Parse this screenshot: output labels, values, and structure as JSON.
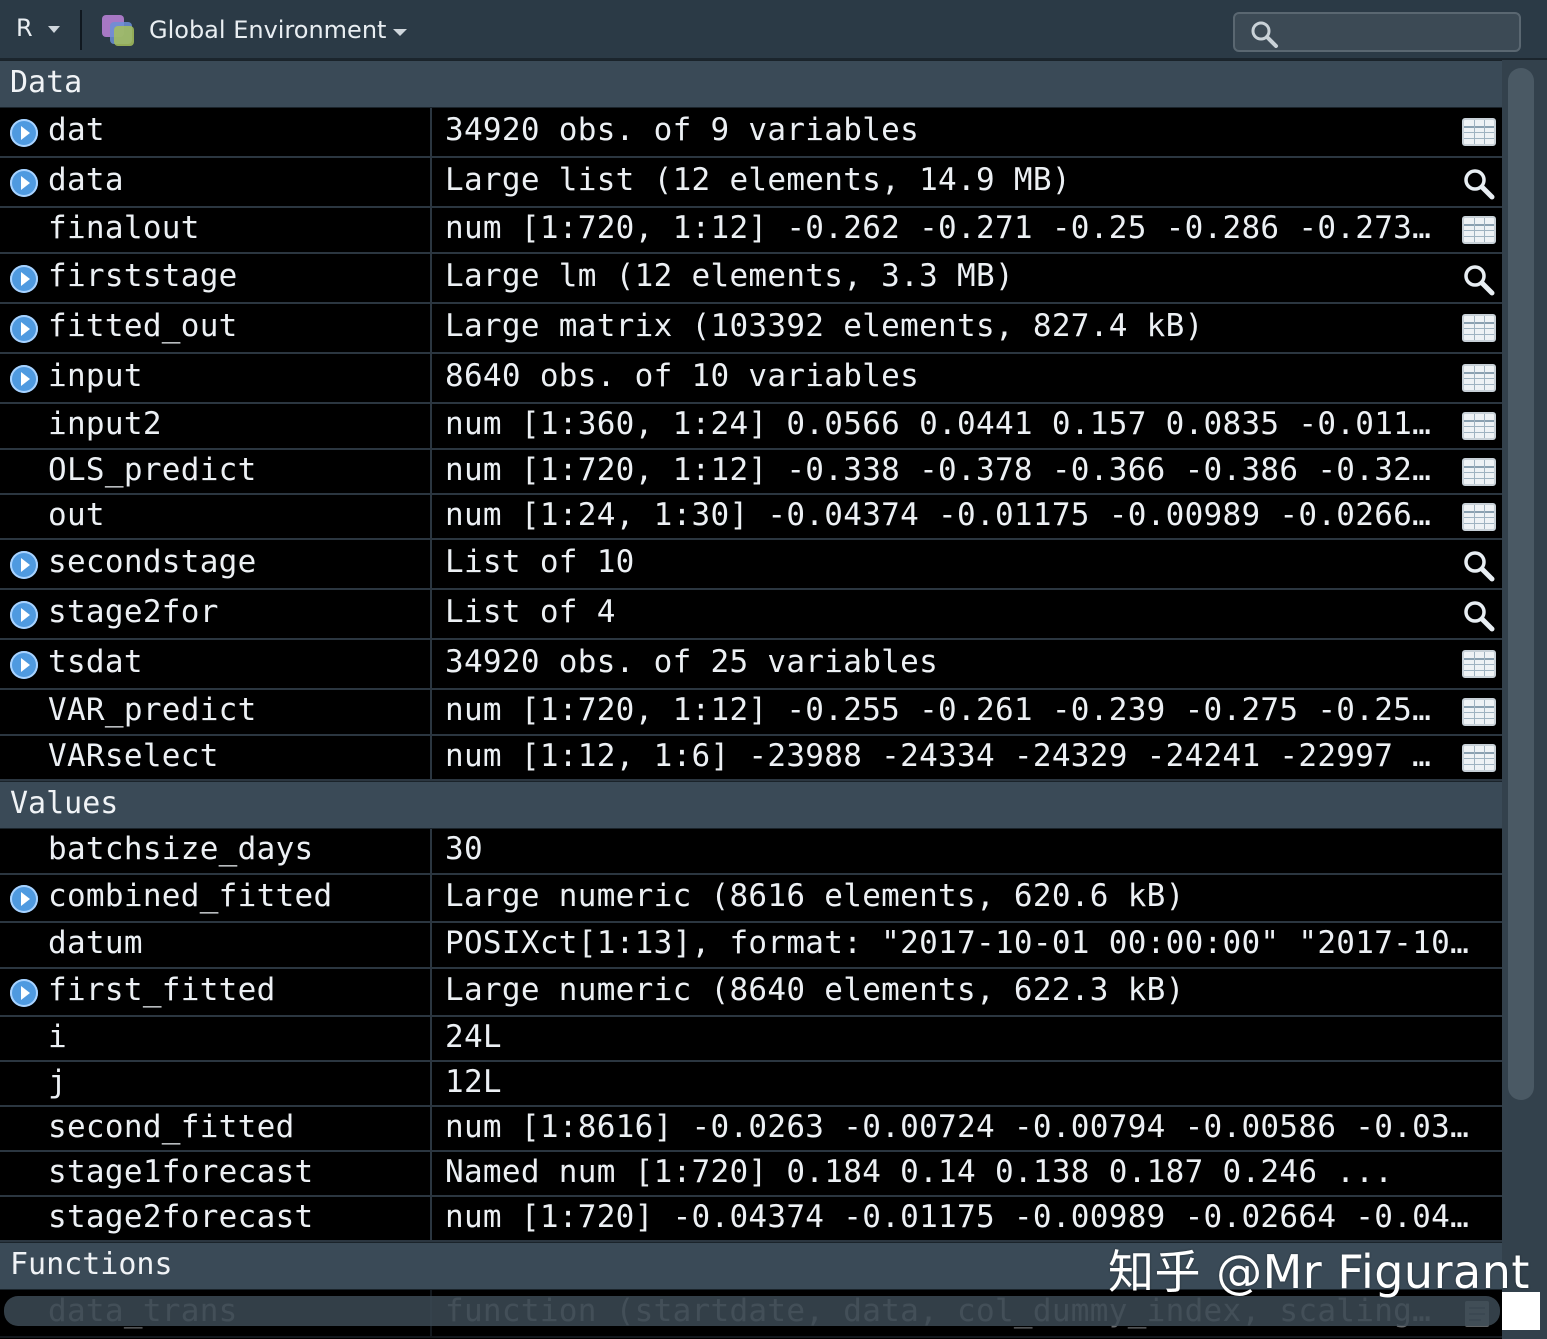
{
  "toolbar": {
    "language": "R",
    "environment": "Global Environment",
    "search_placeholder": ""
  },
  "sections": {
    "data": "Data",
    "values": "Values",
    "functions": "Functions"
  },
  "data_rows": [
    {
      "name": "dat",
      "value": "34920 obs. of 9 variables",
      "expandable": true,
      "action": "grid-icon"
    },
    {
      "name": "data",
      "value": "Large list (12 elements,  14.9 MB)",
      "expandable": true,
      "action": "magnifier-icon"
    },
    {
      "name": "finalout",
      "value": "num [1:720, 1:12] -0.262 -0.271 -0.25 -0.286 -0.273…",
      "expandable": false,
      "action": "grid-icon"
    },
    {
      "name": "firststage",
      "value": "Large lm (12 elements,  3.3 MB)",
      "expandable": true,
      "action": "magnifier-icon"
    },
    {
      "name": "fitted_out",
      "value": "Large matrix (103392 elements,  827.4 kB)",
      "expandable": true,
      "action": "grid-icon"
    },
    {
      "name": "input",
      "value": "8640 obs. of 10 variables",
      "expandable": true,
      "action": "grid-icon"
    },
    {
      "name": "input2",
      "value": "num [1:360, 1:24] 0.0566 0.0441 0.157 0.0835 -0.011…",
      "expandable": false,
      "action": "grid-icon"
    },
    {
      "name": "OLS_predict",
      "value": "num [1:720, 1:12] -0.338 -0.378 -0.366 -0.386 -0.32…",
      "expandable": false,
      "action": "grid-icon"
    },
    {
      "name": "out",
      "value": "num [1:24, 1:30] -0.04374 -0.01175 -0.00989 -0.0266…",
      "expandable": false,
      "action": "grid-icon"
    },
    {
      "name": "secondstage",
      "value": "List of  10",
      "expandable": true,
      "action": "magnifier-icon"
    },
    {
      "name": "stage2for",
      "value": "List of  4",
      "expandable": true,
      "action": "magnifier-icon"
    },
    {
      "name": "tsdat",
      "value": "34920 obs. of 25 variables",
      "expandable": true,
      "action": "grid-icon"
    },
    {
      "name": "VAR_predict",
      "value": "num [1:720, 1:12] -0.255 -0.261 -0.239 -0.275 -0.25…",
      "expandable": false,
      "action": "grid-icon"
    },
    {
      "name": "VARselect",
      "value": "num [1:12, 1:6] -23988 -24334 -24329 -24241 -22997 …",
      "expandable": false,
      "action": "grid-icon"
    }
  ],
  "value_rows": [
    {
      "name": "batchsize_days",
      "value": "30",
      "expandable": false
    },
    {
      "name": "combined_fitted",
      "value": "Large numeric (8616 elements,  620.6 kB)",
      "expandable": true
    },
    {
      "name": "datum",
      "value": "POSIXct[1:13], format: \"2017-10-01 00:00:00\" \"2017-10…",
      "expandable": false
    },
    {
      "name": "first_fitted",
      "value": "Large numeric (8640 elements,  622.3 kB)",
      "expandable": true
    },
    {
      "name": "i",
      "value": "24L",
      "expandable": false
    },
    {
      "name": "j",
      "value": "12L",
      "expandable": false
    },
    {
      "name": "second_fitted",
      "value": "num [1:8616] -0.0263 -0.00724 -0.00794 -0.00586 -0.03…",
      "expandable": false
    },
    {
      "name": "stage1forecast",
      "value": "Named num [1:720] 0.184 0.14 0.138 0.187 0.246 ...",
      "expandable": false
    },
    {
      "name": "stage2forecast",
      "value": "num [1:720] -0.04374 -0.01175 -0.00989 -0.02664 -0.04…",
      "expandable": false
    }
  ],
  "function_rows": [
    {
      "name": "data_trans",
      "value": "function (startdate, data, col_dummy_index, scaling…",
      "expandable": false,
      "action": "script-icon"
    }
  ],
  "watermark": "知乎 @Mr Figurant",
  "colors": {
    "toolbar_bg": "#2b3a46",
    "section_bg": "#3a4a57",
    "row_bg": "#000000",
    "expand_icon": "#4f9ae0"
  }
}
